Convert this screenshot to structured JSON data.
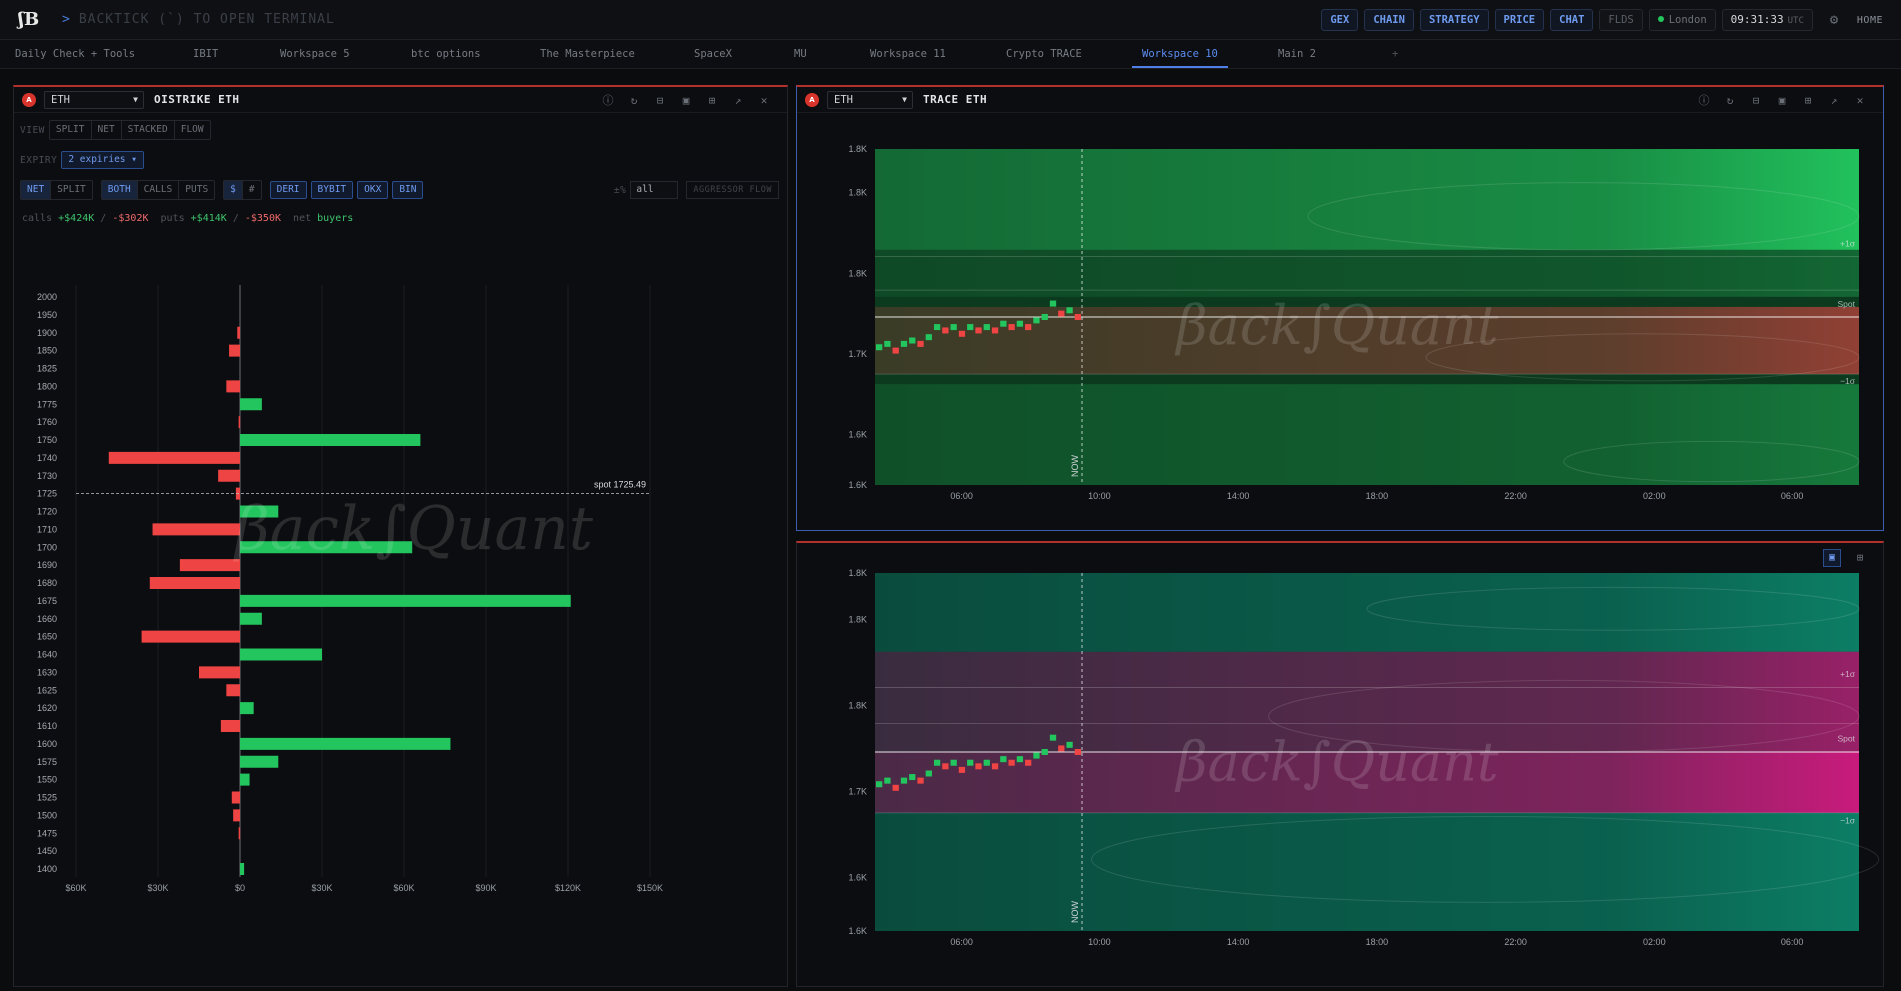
{
  "topbar": {
    "logo": "ʃB",
    "terminal_prompt": ">",
    "terminal_hint": "BACKTICK (`) TO OPEN TERMINAL",
    "buttons": [
      "GEX",
      "CHAIN",
      "STRATEGY",
      "PRICE",
      "CHAT"
    ],
    "flds": "FLDS",
    "location": "London",
    "clock": "09:31:33",
    "clock_tz": "UTC",
    "home": "HOME",
    "colors": {
      "accent": "#4f7ee8",
      "live": "#23c55e"
    }
  },
  "tabs": [
    {
      "label": "Daily Check + Tools"
    },
    {
      "label": "IBIT"
    },
    {
      "label": "Workspace 5"
    },
    {
      "label": "btc options"
    },
    {
      "label": "The Masterpiece"
    },
    {
      "label": "SpaceX"
    },
    {
      "label": "MU"
    },
    {
      "label": "Workspace 11"
    },
    {
      "label": "Crypto TRACE"
    },
    {
      "label": "Workspace 10",
      "active": true
    },
    {
      "label": "Main 2"
    },
    {
      "label": "+"
    }
  ],
  "left_panel": {
    "badge": "A",
    "asset": "ETH",
    "title": "OISTRIKE ETH",
    "view_label": "VIEW",
    "view_options": [
      "SPLIT",
      "NET",
      "STACKED",
      "FLOW"
    ],
    "expiry_label": "EXPIRY",
    "expiry_value": "2 expiries ▾",
    "mode_options": [
      "NET",
      "SPLIT"
    ],
    "side_options": [
      "BOTH",
      "CALLS",
      "PUTS"
    ],
    "unit_options": [
      "$",
      "#"
    ],
    "exchanges": [
      "DERI",
      "BYBIT",
      "OKX",
      "BIN"
    ],
    "pct_label": "±%",
    "pct_value": "all",
    "aggressor_button": "AGGRESSOR FLOW",
    "summary": {
      "calls_label": "calls",
      "calls_buy": "+$424K",
      "sep1": "/",
      "calls_sell": "-$302K",
      "puts_label": "puts",
      "puts_buy": "+$414K",
      "sep2": "/",
      "puts_sell": "-$350K",
      "net_label": "net",
      "net_value": "buyers"
    }
  },
  "chart_data": [
    {
      "type": "bar",
      "orientation": "horizontal",
      "categories": [
        "2000",
        "1950",
        "1900",
        "1850",
        "1825",
        "1800",
        "1775",
        "1760",
        "1750",
        "1740",
        "1730",
        "1725",
        "1720",
        "1710",
        "1700",
        "1690",
        "1680",
        "1675",
        "1660",
        "1650",
        "1640",
        "1630",
        "1625",
        "1620",
        "1610",
        "1600",
        "1575",
        "1550",
        "1525",
        "1500",
        "1475",
        "1450",
        "1400"
      ],
      "values": [
        0,
        0,
        -1000,
        -4000,
        0,
        -5000,
        8000,
        -500,
        66000,
        -48000,
        -8000,
        -1500,
        14000,
        -32000,
        63000,
        -22000,
        -33000,
        121000,
        8000,
        -36000,
        30000,
        -15000,
        -5000,
        5000,
        -7000,
        77000,
        14000,
        3500,
        -3000,
        -2500,
        -500,
        0,
        1500
      ],
      "xlim": [
        -60000,
        150000
      ],
      "x_ticks": [
        "$60K",
        "$30K",
        "$0",
        "$30K",
        "$60K",
        "$90K",
        "$120K",
        "$150K"
      ],
      "annotation": "spot 1725.49",
      "spot_category": "1725",
      "watermark": "βack∫Quant",
      "colors": {
        "positive": "#23c55e",
        "negative": "#ef4444"
      }
    },
    {
      "type": "heatmap",
      "title": "TRACE ETH",
      "y_ticks": [
        "1.8K",
        "1.8K",
        "1.8K",
        "1.7K",
        "1.6K",
        "1.6K"
      ],
      "x_ticks": [
        "06:00",
        "10:00",
        "14:00",
        "18:00",
        "22:00",
        "02:00",
        "06:00"
      ],
      "now_label": "NOW",
      "level_labels": [
        "+1σ",
        "Spot",
        "−1σ"
      ],
      "watermark": "βack∫Quant",
      "colors": {
        "bid": "#22c55e",
        "ask": "#ef4444"
      }
    },
    {
      "type": "heatmap",
      "y_ticks": [
        "1.8K",
        "1.8K",
        "1.8K",
        "1.7K",
        "1.6K",
        "1.6K"
      ],
      "x_ticks": [
        "06:00",
        "10:00",
        "14:00",
        "18:00",
        "22:00",
        "02:00",
        "06:00"
      ],
      "now_label": "NOW",
      "level_labels": [
        "+1σ",
        "Spot",
        "−1σ"
      ],
      "watermark": "βack∫Quant",
      "colors": {
        "bid": "#12f5c0",
        "ask": "#ff1493"
      }
    }
  ],
  "right_top_panel": {
    "badge": "A",
    "asset": "ETH",
    "title": "TRACE ETH"
  }
}
